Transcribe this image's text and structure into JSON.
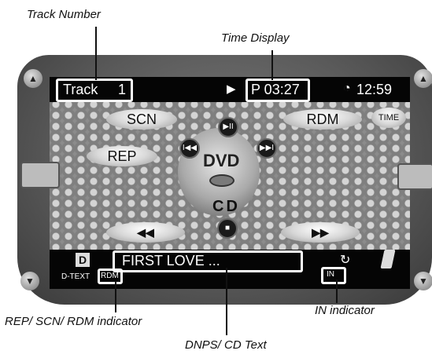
{
  "callouts": {
    "track_number": "Track Number",
    "time_display": "Time Display",
    "rep_scn_rdm": "REP/ SCN/ RDM indicator",
    "in_indicator": "IN indicator",
    "dnps_cd_text": "DNPS/ CD Text"
  },
  "top_bar": {
    "track_label": "Track",
    "track_number": "1",
    "play_icon": "play-icon",
    "time_value": "P 03:27",
    "clock_time": "12:59"
  },
  "controls": {
    "scn": "SCN",
    "rdm": "RDM",
    "rep": "REP",
    "time_button": "TIME",
    "play_pause": "▶II",
    "prev": "I◀◀",
    "next": "▶▶I",
    "dvd": "DVD",
    "cd": "CD",
    "rewind": "◀◀",
    "fast_forward": "▶▶"
  },
  "bottom_bar": {
    "d_icon": "D",
    "d_text": "D-TEXT",
    "rdm_indicator": "RDM",
    "cd_text": "FIRST LOVE ...",
    "in_indicator": "IN"
  },
  "colors": {
    "bar": "#050505",
    "accent": "#ffffff"
  }
}
